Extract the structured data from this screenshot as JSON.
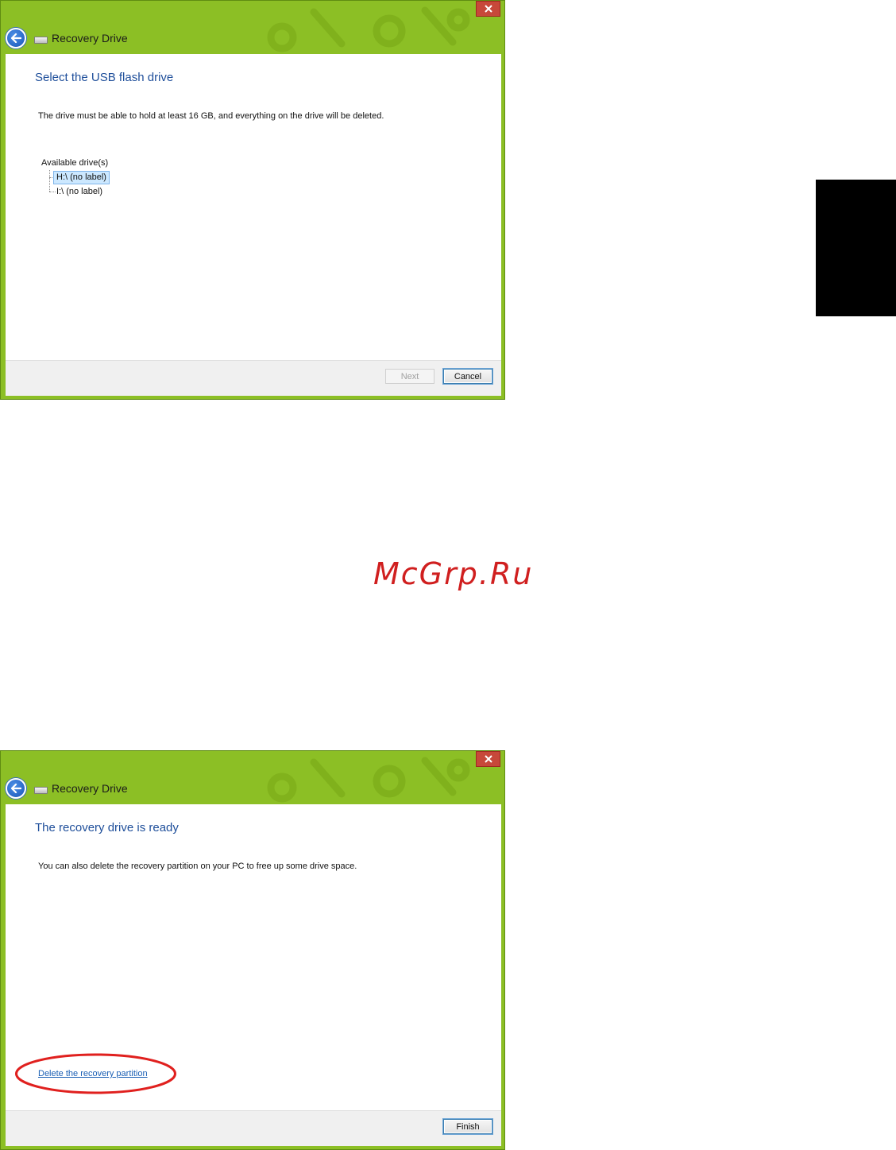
{
  "windows": [
    {
      "title": "Recovery Drive",
      "heading": "Select the USB flash drive",
      "description": "The drive must be able to hold at least 16 GB, and everything on the drive will be deleted.",
      "drives_label": "Available drive(s)",
      "drives": [
        {
          "label": "H:\\ (no label)",
          "selected": true
        },
        {
          "label": "I:\\ (no label)",
          "selected": false
        }
      ],
      "buttons": {
        "next": "Next",
        "cancel": "Cancel"
      }
    },
    {
      "title": "Recovery Drive",
      "heading": "The recovery drive is ready",
      "description": "You can also delete the recovery partition on your PC to free up some drive space.",
      "link": "Delete the recovery partition",
      "buttons": {
        "finish": "Finish"
      }
    }
  ],
  "watermark": "McGrp.Ru",
  "colors": {
    "titlebar_green": "#8cbf25",
    "heading_blue": "#1e4e9a",
    "link_blue": "#1a5fb4",
    "highlight_red": "#e0201e"
  },
  "icons": [
    "close-icon",
    "back-arrow-icon",
    "drive-icon"
  ]
}
